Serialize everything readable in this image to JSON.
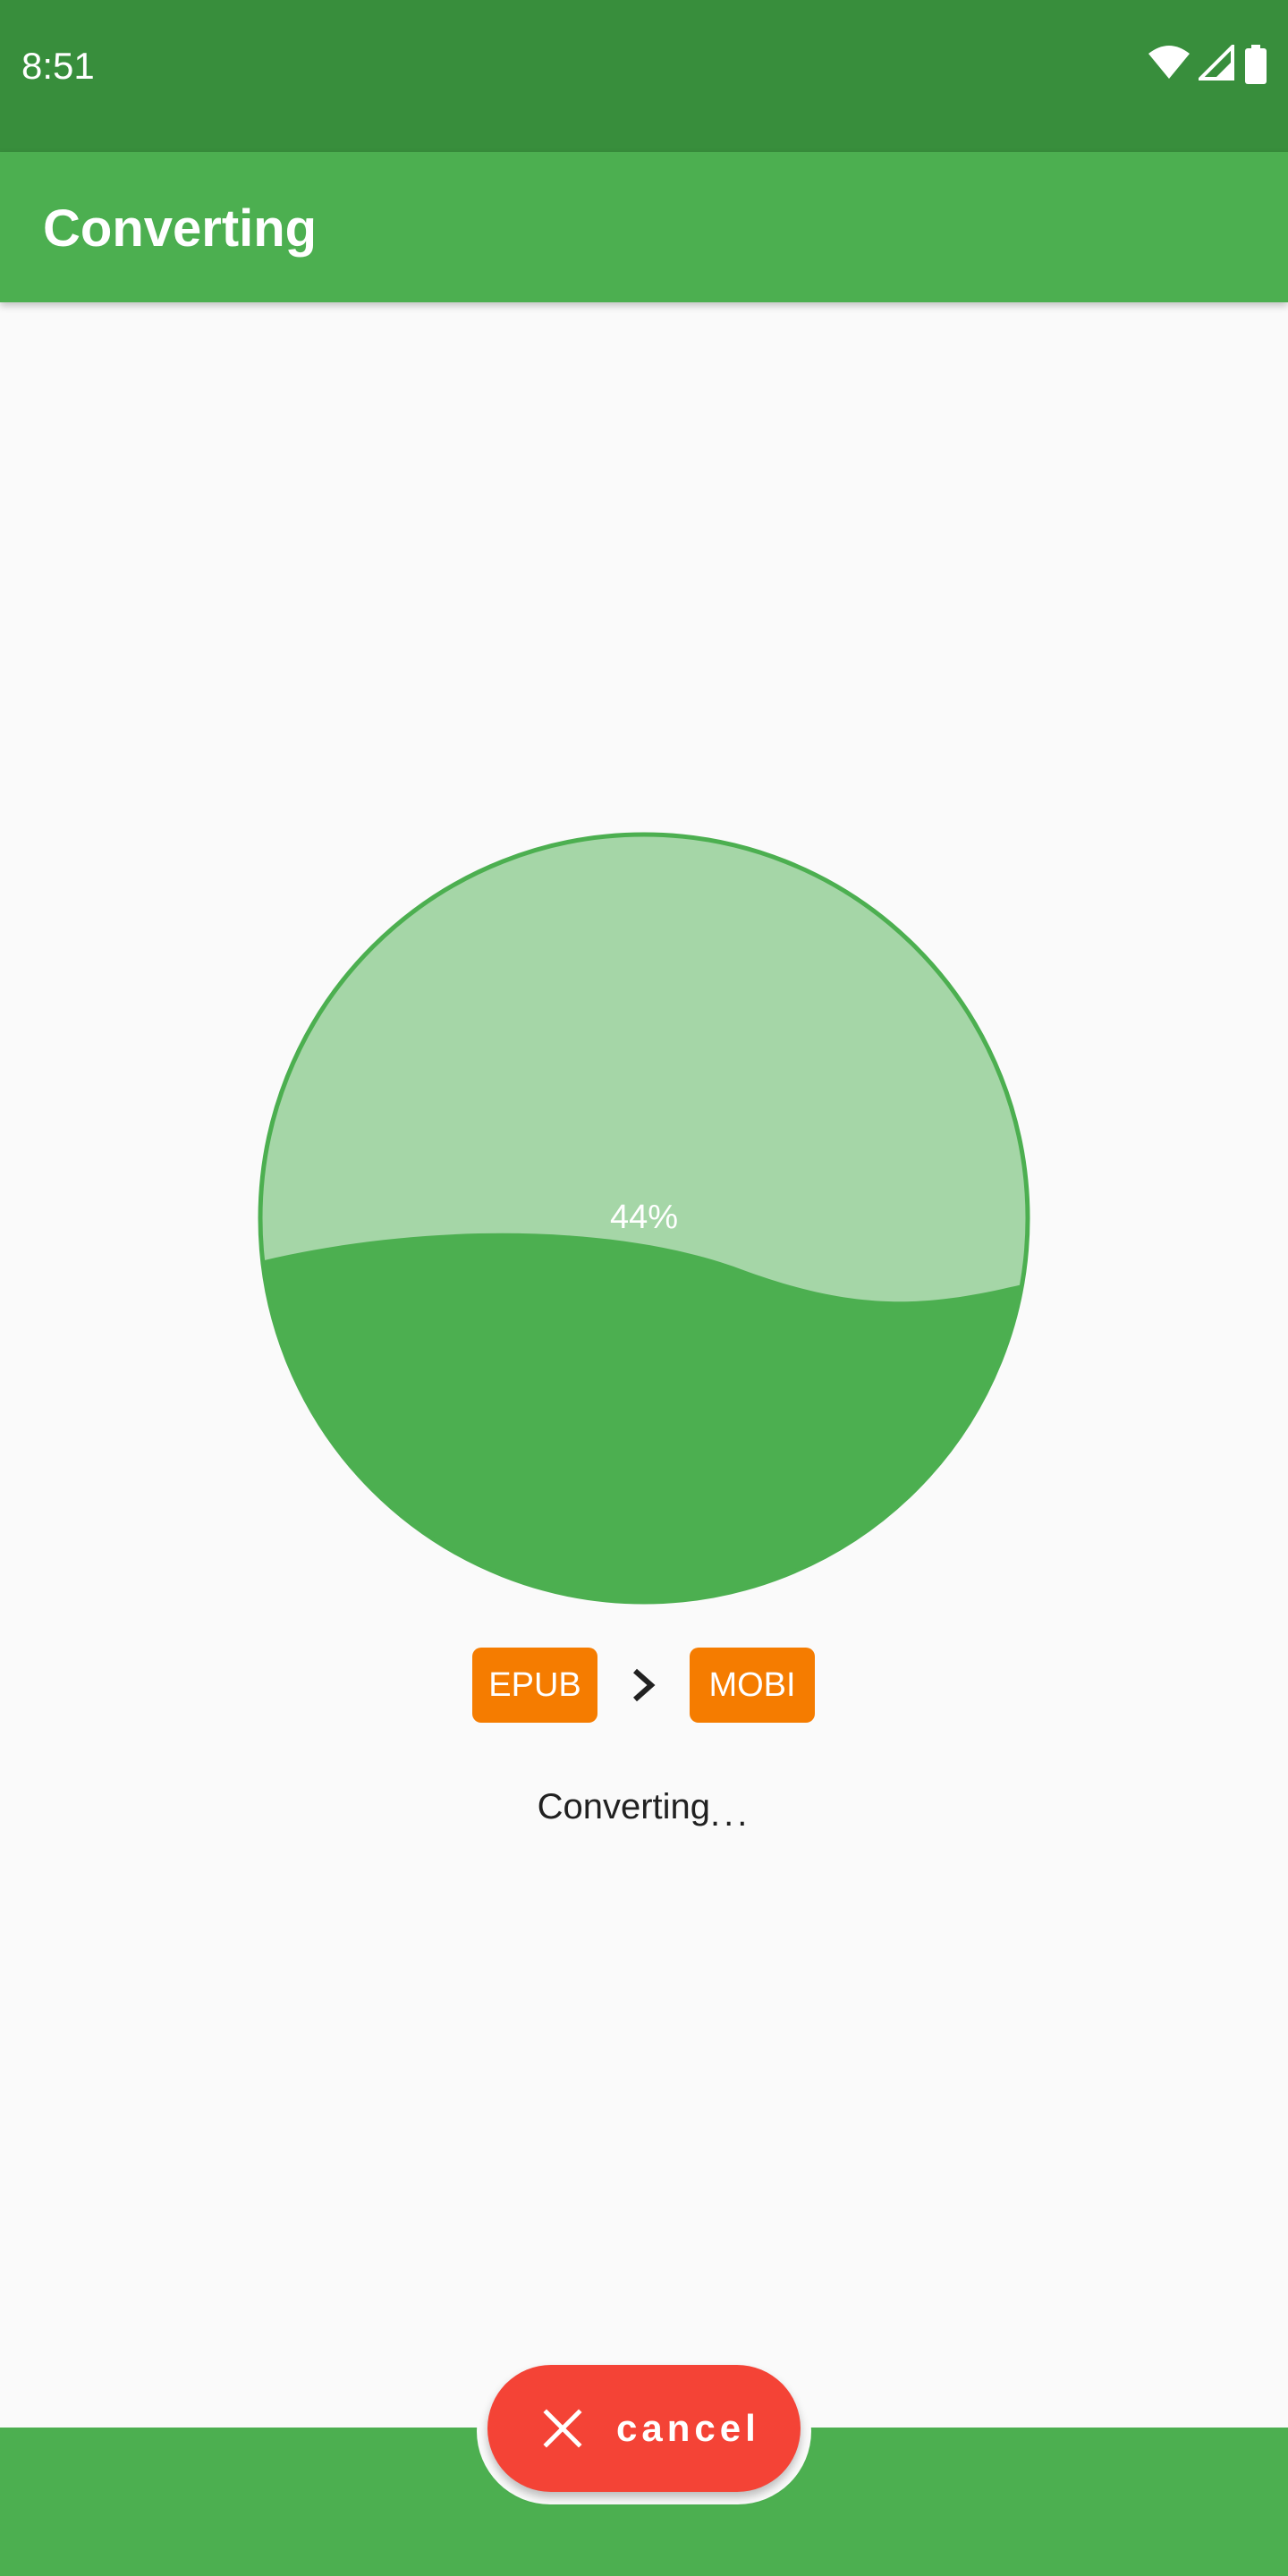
{
  "status_bar": {
    "time": "8:51",
    "icons": [
      "wifi-icon",
      "signal-icon",
      "battery-icon"
    ]
  },
  "app_bar": {
    "title": "Converting"
  },
  "progress": {
    "value": 0.44,
    "label": "44%",
    "colors": {
      "fill": "#4CAF50",
      "empty": "#A5D6A7",
      "border": "#4CAF50"
    }
  },
  "conversion": {
    "from_format": "EPUB",
    "to_format": "MOBI",
    "arrow_icon": "chevron-right-icon",
    "status_text": "Converting",
    "status_dots": "..."
  },
  "actions": {
    "cancel_label": "cancel",
    "cancel_icon": "close-icon",
    "cancel_color": "#F44336"
  },
  "colors": {
    "status_bar": "#388E3C",
    "primary": "#4CAF50",
    "badge": "#F57C00",
    "background": "#FAFAFA"
  }
}
